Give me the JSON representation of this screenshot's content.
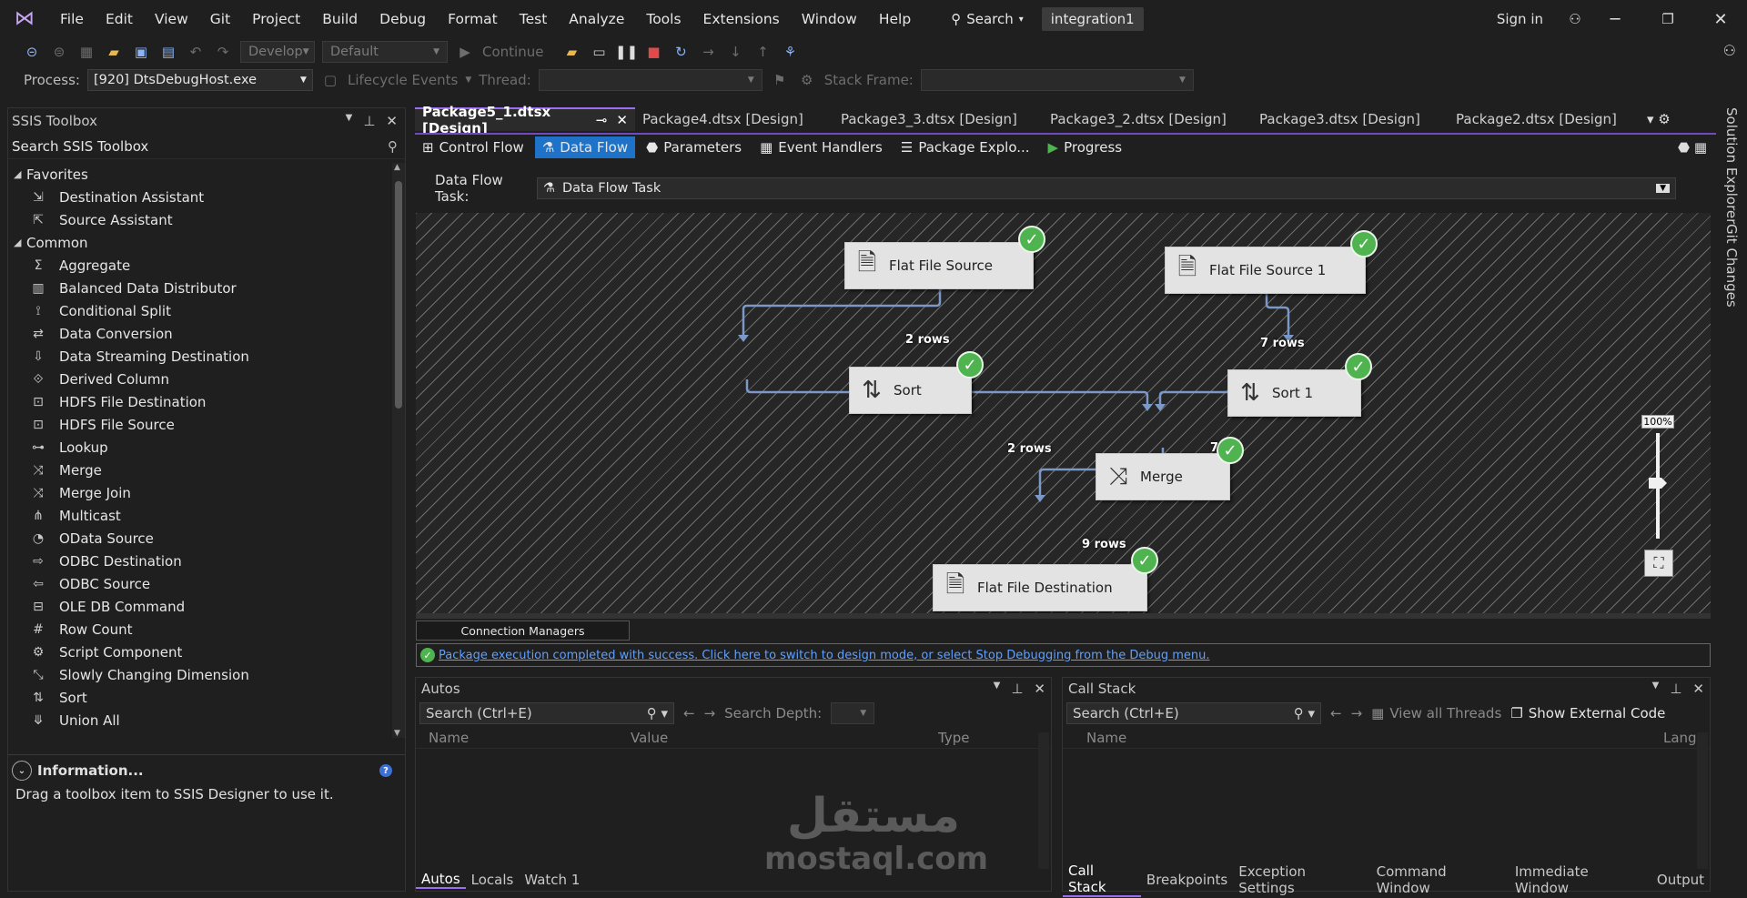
{
  "menu": {
    "items": [
      "File",
      "Edit",
      "View",
      "Git",
      "Project",
      "Build",
      "Debug",
      "Format",
      "Test",
      "Analyze",
      "Tools",
      "Extensions",
      "Window",
      "Help"
    ],
    "search_label": "Search",
    "solution_name": "integration1",
    "sign_in": "Sign in"
  },
  "toolbar": {
    "config": "Develop",
    "platform": "Default",
    "continue_label": "Continue",
    "process_label": "Process:",
    "process_value": "[920] DtsDebugHost.exe",
    "lifecycle_label": "Lifecycle Events",
    "thread_label": "Thread:",
    "stack_frame_label": "Stack Frame:"
  },
  "toolbox": {
    "title": "SSIS Toolbox",
    "search_placeholder": "Search SSIS Toolbox",
    "favorites_label": "Favorites",
    "favorites": [
      "Destination Assistant",
      "Source Assistant"
    ],
    "common_label": "Common",
    "common": [
      "Aggregate",
      "Balanced Data Distributor",
      "Conditional Split",
      "Data Conversion",
      "Data Streaming Destination",
      "Derived Column",
      "HDFS File Destination",
      "HDFS File Source",
      "Lookup",
      "Merge",
      "Merge Join",
      "Multicast",
      "OData Source",
      "ODBC Destination",
      "ODBC Source",
      "OLE DB Command",
      "Row Count",
      "Script Component",
      "Slowly Changing Dimension",
      "Sort",
      "Union All"
    ],
    "info_title": "Information...",
    "info_text": "Drag a toolbox item to SSIS Designer to use it."
  },
  "doc_tabs": [
    "Package5_1.dtsx [Design]",
    "Package4.dtsx [Design]",
    "Package3_3.dtsx [Design]",
    "Package3_2.dtsx [Design]",
    "Package3.dtsx [Design]",
    "Package2.dtsx [Design]"
  ],
  "design_tabs": [
    "Control Flow",
    "Data Flow",
    "Parameters",
    "Event Handlers",
    "Package Explo...",
    "Progress"
  ],
  "data_flow": {
    "task_label": "Data Flow Task:",
    "task_value": "Data Flow Task",
    "nodes": {
      "ffs": "Flat File Source",
      "ffs1": "Flat File Source 1",
      "sort": "Sort",
      "sort1": "Sort 1",
      "merge": "Merge",
      "ffd": "Flat File Destination"
    },
    "rows": {
      "ffs_sort": "2 rows",
      "ffs1_sort1": "7 rows",
      "sort_merge": "2 rows",
      "sort1_merge": "7",
      "merge_ffd": "9 rows"
    },
    "zoom": "100%"
  },
  "connection_managers": "Connection Managers",
  "status_message": "Package execution completed with success. Click here to switch to design mode, or select Stop Debugging from the Debug menu.",
  "autos": {
    "title": "Autos",
    "search": "Search (Ctrl+E)",
    "depth_label": "Search Depth:",
    "cols": [
      "Name",
      "Value",
      "Type"
    ],
    "tabs": [
      "Autos",
      "Locals",
      "Watch 1"
    ]
  },
  "callstack": {
    "title": "Call Stack",
    "search": "Search (Ctrl+E)",
    "view_threads": "View all Threads",
    "show_external": "Show External Code",
    "cols": [
      "Name",
      "Lang"
    ],
    "tabs": [
      "Call Stack",
      "Breakpoints",
      "Exception Settings",
      "Command Window",
      "Immediate Window",
      "Output"
    ]
  },
  "side_tabs": [
    "Solution Explorer",
    "Git Changes"
  ],
  "watermark": {
    "arabic": "مستقل",
    "latin": "mostaql.com"
  }
}
